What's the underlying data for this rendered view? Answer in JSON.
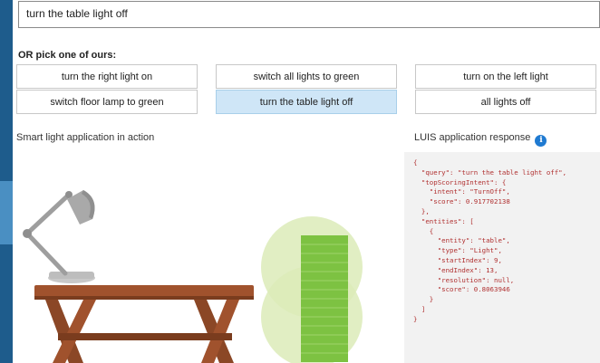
{
  "query": {
    "value": "turn the table light off"
  },
  "pick": {
    "title": "OR pick one of ours:",
    "buttons": [
      "turn the right light on",
      "switch all lights to green",
      "turn on the left light",
      "switch floor lamp to green",
      "turn the table light off",
      "all lights off"
    ]
  },
  "scene": {
    "label": "Smart light application in action"
  },
  "response": {
    "label": "LUIS application response",
    "info": "i",
    "json_lines": [
      "{",
      "  \"query\": \"turn the table light off\",",
      "  \"topScoringIntent\": {",
      "    \"intent\": \"TurnOff\",",
      "    \"score\": 0.917702138",
      "  },",
      "  \"entities\": [",
      "    {",
      "      \"entity\": \"table\",",
      "      \"type\": \"Light\",",
      "      \"startIndex\": 9,",
      "      \"endIndex\": 13,",
      "      \"resolution\": null,",
      "      \"score\": 0.8063946",
      "    }",
      "  ]",
      "}"
    ]
  },
  "colors": {
    "selected_button": "#cfe6f7",
    "json_text": "#b03030",
    "lamp_green": "#7dc242",
    "table_wood": "#a0522d"
  }
}
